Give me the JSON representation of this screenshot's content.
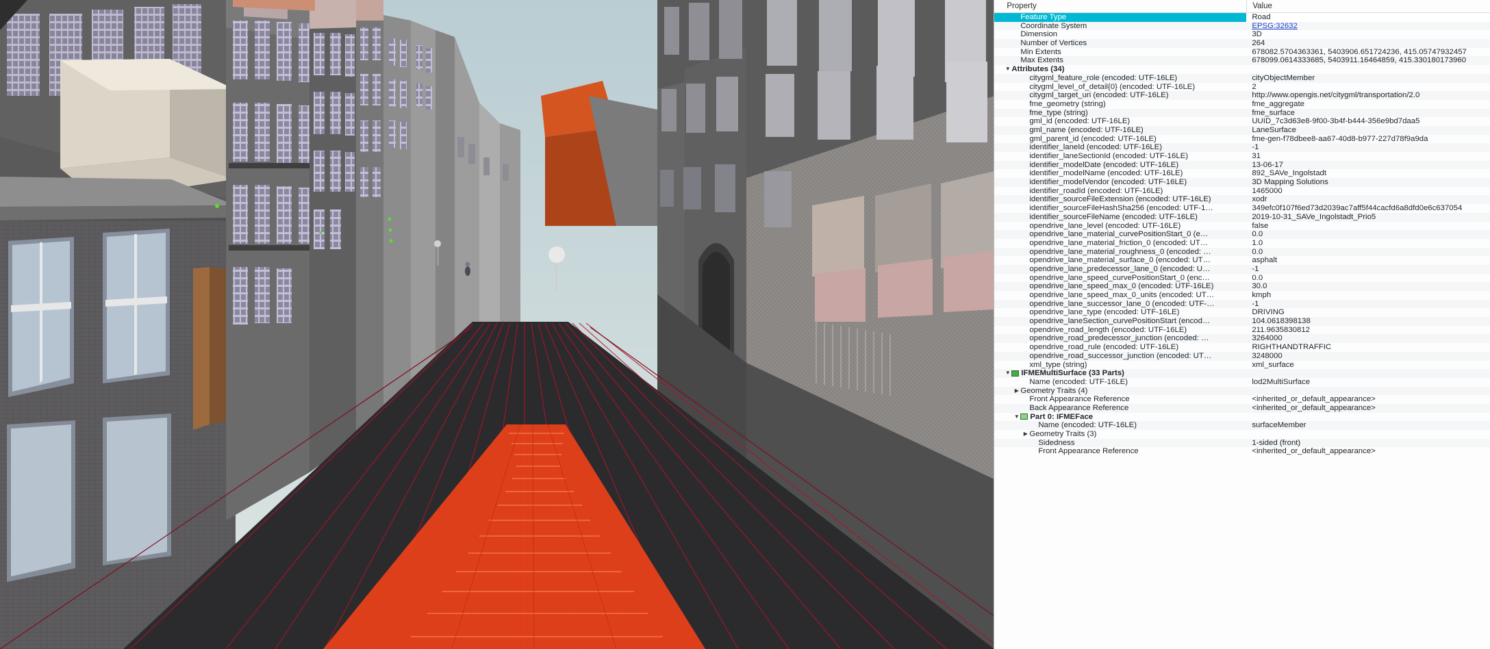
{
  "viewport": {
    "name": "3d-scene-viewport",
    "description": "3D city model street view with red road lane geometry highlighted"
  },
  "panel": {
    "columns": {
      "property": "Property",
      "value": "Value"
    },
    "rows": [
      {
        "indent": 1,
        "twisty": "none",
        "label": "Feature Type",
        "value": "Road",
        "selected": true
      },
      {
        "indent": 1,
        "twisty": "none",
        "label": "Coordinate System",
        "value": "EPSG:32632",
        "link": true
      },
      {
        "indent": 1,
        "twisty": "none",
        "label": "Dimension",
        "value": "3D"
      },
      {
        "indent": 1,
        "twisty": "none",
        "label": "Number of Vertices",
        "value": "264"
      },
      {
        "indent": 1,
        "twisty": "none",
        "label": "Min Extents",
        "value": "678082.5704363361, 5403906.651724236, 415.05747932457"
      },
      {
        "indent": 1,
        "twisty": "none",
        "label": "Max Extents",
        "value": "678099.0614333685, 5403911.16464859, 415.330180173960"
      },
      {
        "indent": 0,
        "twisty": "down",
        "label": "Attributes (34)",
        "value": "",
        "bold": true
      },
      {
        "indent": 2,
        "twisty": "none",
        "label": "citygml_feature_role (encoded: UTF-16LE)",
        "value": "cityObjectMember"
      },
      {
        "indent": 2,
        "twisty": "none",
        "label": "citygml_level_of_detail{0} (encoded: UTF-16LE)",
        "value": "2"
      },
      {
        "indent": 2,
        "twisty": "none",
        "label": "citygml_target_uri (encoded: UTF-16LE)",
        "value": "http://www.opengis.net/citygml/transportation/2.0"
      },
      {
        "indent": 2,
        "twisty": "none",
        "label": "fme_geometry (string)",
        "value": "fme_aggregate"
      },
      {
        "indent": 2,
        "twisty": "none",
        "label": "fme_type (string)",
        "value": "fme_surface"
      },
      {
        "indent": 2,
        "twisty": "none",
        "label": "gml_id (encoded: UTF-16LE)",
        "value": "UUID_7c3d63e8-9f00-3b4f-b444-356e9bd7daa5"
      },
      {
        "indent": 2,
        "twisty": "none",
        "label": "gml_name (encoded: UTF-16LE)",
        "value": "LaneSurface"
      },
      {
        "indent": 2,
        "twisty": "none",
        "label": "gml_parent_id (encoded: UTF-16LE)",
        "value": "fme-gen-f78dbee8-aa67-40d8-b977-227d78f9a9da"
      },
      {
        "indent": 2,
        "twisty": "none",
        "label": "identifier_laneId (encoded: UTF-16LE)",
        "value": "-1"
      },
      {
        "indent": 2,
        "twisty": "none",
        "label": "identifier_laneSectionId (encoded: UTF-16LE)",
        "value": "31"
      },
      {
        "indent": 2,
        "twisty": "none",
        "label": "identifier_modelDate (encoded: UTF-16LE)",
        "value": "13-06-17"
      },
      {
        "indent": 2,
        "twisty": "none",
        "label": "identifier_modelName (encoded: UTF-16LE)",
        "value": "892_SAVe_Ingolstadt"
      },
      {
        "indent": 2,
        "twisty": "none",
        "label": "identifier_modelVendor (encoded: UTF-16LE)",
        "value": "3D Mapping Solutions"
      },
      {
        "indent": 2,
        "twisty": "none",
        "label": "identifier_roadId (encoded: UTF-16LE)",
        "value": "1465000"
      },
      {
        "indent": 2,
        "twisty": "none",
        "label": "identifier_sourceFileExtension (encoded: UTF-16LE)",
        "value": "xodr"
      },
      {
        "indent": 2,
        "twisty": "none",
        "label": "identifier_sourceFileHashSha256 (encoded: UTF-1…",
        "value": "349efc0f107f6ed73d2039ac7aff5f44cacfd6a8dfd0e6c637054"
      },
      {
        "indent": 2,
        "twisty": "none",
        "label": "identifier_sourceFileName (encoded: UTF-16LE)",
        "value": "2019-10-31_SAVe_Ingolstadt_Prio5"
      },
      {
        "indent": 2,
        "twisty": "none",
        "label": "opendrive_lane_level (encoded: UTF-16LE)",
        "value": "false"
      },
      {
        "indent": 2,
        "twisty": "none",
        "label": "opendrive_lane_material_curvePositionStart_0 (e…",
        "value": "0.0"
      },
      {
        "indent": 2,
        "twisty": "none",
        "label": "opendrive_lane_material_friction_0 (encoded: UT…",
        "value": "1.0"
      },
      {
        "indent": 2,
        "twisty": "none",
        "label": "opendrive_lane_material_roughness_0 (encoded: …",
        "value": "0.0"
      },
      {
        "indent": 2,
        "twisty": "none",
        "label": "opendrive_lane_material_surface_0 (encoded: UT…",
        "value": "asphalt"
      },
      {
        "indent": 2,
        "twisty": "none",
        "label": "opendrive_lane_predecessor_lane_0 (encoded: U…",
        "value": "-1"
      },
      {
        "indent": 2,
        "twisty": "none",
        "label": "opendrive_lane_speed_curvePositionStart_0 (enc…",
        "value": "0.0"
      },
      {
        "indent": 2,
        "twisty": "none",
        "label": "opendrive_lane_speed_max_0 (encoded: UTF-16LE)",
        "value": "30.0"
      },
      {
        "indent": 2,
        "twisty": "none",
        "label": "opendrive_lane_speed_max_0_units (encoded: UT…",
        "value": "kmph"
      },
      {
        "indent": 2,
        "twisty": "none",
        "label": "opendrive_lane_successor_lane_0 (encoded: UTF-…",
        "value": "-1"
      },
      {
        "indent": 2,
        "twisty": "none",
        "label": "opendrive_lane_type (encoded: UTF-16LE)",
        "value": "DRIVING"
      },
      {
        "indent": 2,
        "twisty": "none",
        "label": "opendrive_laneSection_curvePositionStart (encod…",
        "value": "104.0618398138"
      },
      {
        "indent": 2,
        "twisty": "none",
        "label": "opendrive_road_length (encoded: UTF-16LE)",
        "value": "211.9635830812"
      },
      {
        "indent": 2,
        "twisty": "none",
        "label": "opendrive_road_predecessor_junction (encoded: …",
        "value": "3264000"
      },
      {
        "indent": 2,
        "twisty": "none",
        "label": "opendrive_road_rule (encoded: UTF-16LE)",
        "value": "RIGHTHANDTRAFFIC"
      },
      {
        "indent": 2,
        "twisty": "none",
        "label": "opendrive_road_successor_junction (encoded: UT…",
        "value": "3248000"
      },
      {
        "indent": 2,
        "twisty": "none",
        "label": "xml_type (string)",
        "value": "xml_surface"
      },
      {
        "indent": 0,
        "twisty": "down",
        "label": "IFMEMultiSurface (33 Parts)",
        "value": "",
        "bold": true,
        "geom": "multisurface"
      },
      {
        "indent": 2,
        "twisty": "none",
        "label": "Name (encoded: UTF-16LE)",
        "value": "lod2MultiSurface"
      },
      {
        "indent": 1,
        "twisty": "right",
        "label": "Geometry Traits (4)",
        "value": ""
      },
      {
        "indent": 2,
        "twisty": "none",
        "label": "Front Appearance Reference",
        "value": "<inherited_or_default_appearance>"
      },
      {
        "indent": 2,
        "twisty": "none",
        "label": "Back Appearance Reference",
        "value": "<inherited_or_default_appearance>"
      },
      {
        "indent": 1,
        "twisty": "down",
        "label": "Part 0: IFMEFace",
        "value": "",
        "bold": true,
        "geom": "face"
      },
      {
        "indent": 3,
        "twisty": "none",
        "label": "Name (encoded: UTF-16LE)",
        "value": "surfaceMember"
      },
      {
        "indent": 2,
        "twisty": "right",
        "label": "Geometry Traits (3)",
        "value": ""
      },
      {
        "indent": 3,
        "twisty": "none",
        "label": "Sidedness",
        "value": "1-sided (front)"
      },
      {
        "indent": 3,
        "twisty": "none",
        "label": "Front Appearance Reference",
        "value": "<inherited_or_default_appearance>"
      }
    ]
  }
}
